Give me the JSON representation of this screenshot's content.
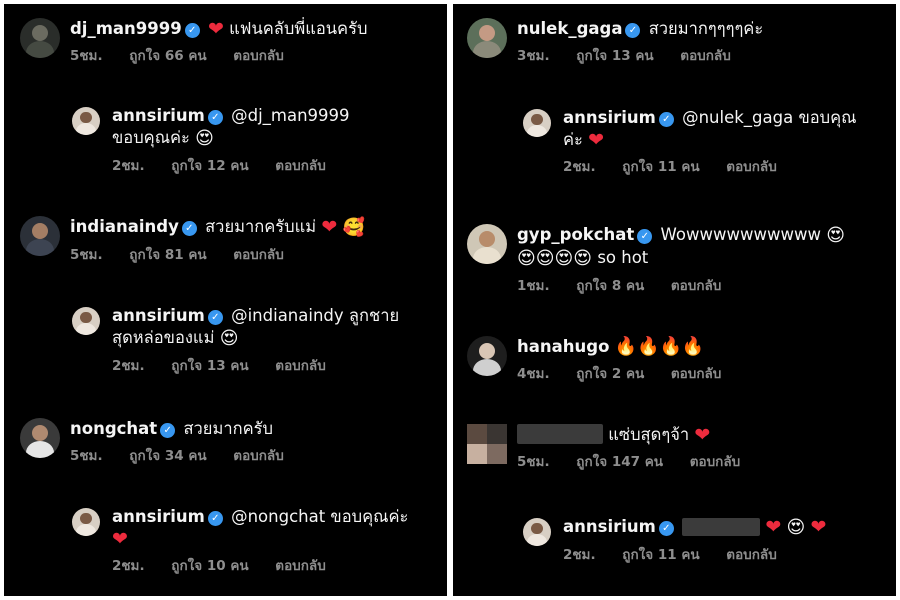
{
  "left": {
    "comments": [
      {
        "username": "dj_man9999",
        "text": "แฟนคลับพี่แอนครับ",
        "time": "5ชม.",
        "likes": "ถูกใจ 66 คน",
        "reply": "ตอบกลับ"
      },
      {
        "username": "annsirium",
        "text": "@dj_man9999 ขอบคุณค่ะ",
        "time": "2ชม.",
        "likes": "ถูกใจ 12 คน",
        "reply": "ตอบกลับ"
      },
      {
        "username": "indianaindy",
        "text": "สวยมากครับแม่",
        "time": "5ชม.",
        "likes": "ถูกใจ 81 คน",
        "reply": "ตอบกลับ"
      },
      {
        "username": "annsirium",
        "text": "@indianaindy ลูกชายสุดหล่อของแม่",
        "time": "2ชม.",
        "likes": "ถูกใจ 13 คน",
        "reply": "ตอบกลับ"
      },
      {
        "username": "nongchat",
        "text": "สวยมากครับ",
        "time": "5ชม.",
        "likes": "ถูกใจ 34 คน",
        "reply": "ตอบกลับ"
      },
      {
        "username": "annsirium",
        "text": "@nongchat ขอบคุณค่ะ",
        "time": "2ชม.",
        "likes": "ถูกใจ 10 คน",
        "reply": "ตอบกลับ"
      }
    ]
  },
  "right": {
    "comments": [
      {
        "username": "nulek_gaga",
        "text": "สวยมากๆๆๆๆค่ะ",
        "time": "3ชม.",
        "likes": "ถูกใจ 13 คน",
        "reply": "ตอบกลับ"
      },
      {
        "username": "annsirium",
        "text": "@nulek_gaga ขอบคุณค่ะ",
        "time": "2ชม.",
        "likes": "ถูกใจ 11 คน",
        "reply": "ตอบกลับ"
      },
      {
        "username": "gyp_pokchat",
        "text": "Wowwwwwwwwww",
        "text2": "so hot",
        "time": "1ชม.",
        "likes": "ถูกใจ 8 คน",
        "reply": "ตอบกลับ"
      },
      {
        "username": "hanahugo",
        "text": "",
        "time": "4ชม.",
        "likes": "ถูกใจ 2 คน",
        "reply": "ตอบกลับ"
      },
      {
        "username": "",
        "text": "แซ่บสุดๆจ้า",
        "time": "5ชม.",
        "likes": "ถูกใจ 147 คน",
        "reply": "ตอบกลับ"
      },
      {
        "username": "annsirium",
        "text": "",
        "time": "2ชม.",
        "likes": "ถูกใจ 11 คน",
        "reply": "ตอบกลับ"
      }
    ]
  },
  "colors": {
    "background": "#000000",
    "text": "#f5f5f5",
    "meta": "#8e8e8e",
    "verified": "#3897f0",
    "heart": "#ed2b3d"
  },
  "icons": {
    "verified": "verified-badge-icon",
    "heart": "red-heart-icon",
    "heart_eyes": "heart-eyes-emoji",
    "smiling_hearts": "smiling-face-with-hearts-emoji",
    "fire": "fire-emoji"
  }
}
